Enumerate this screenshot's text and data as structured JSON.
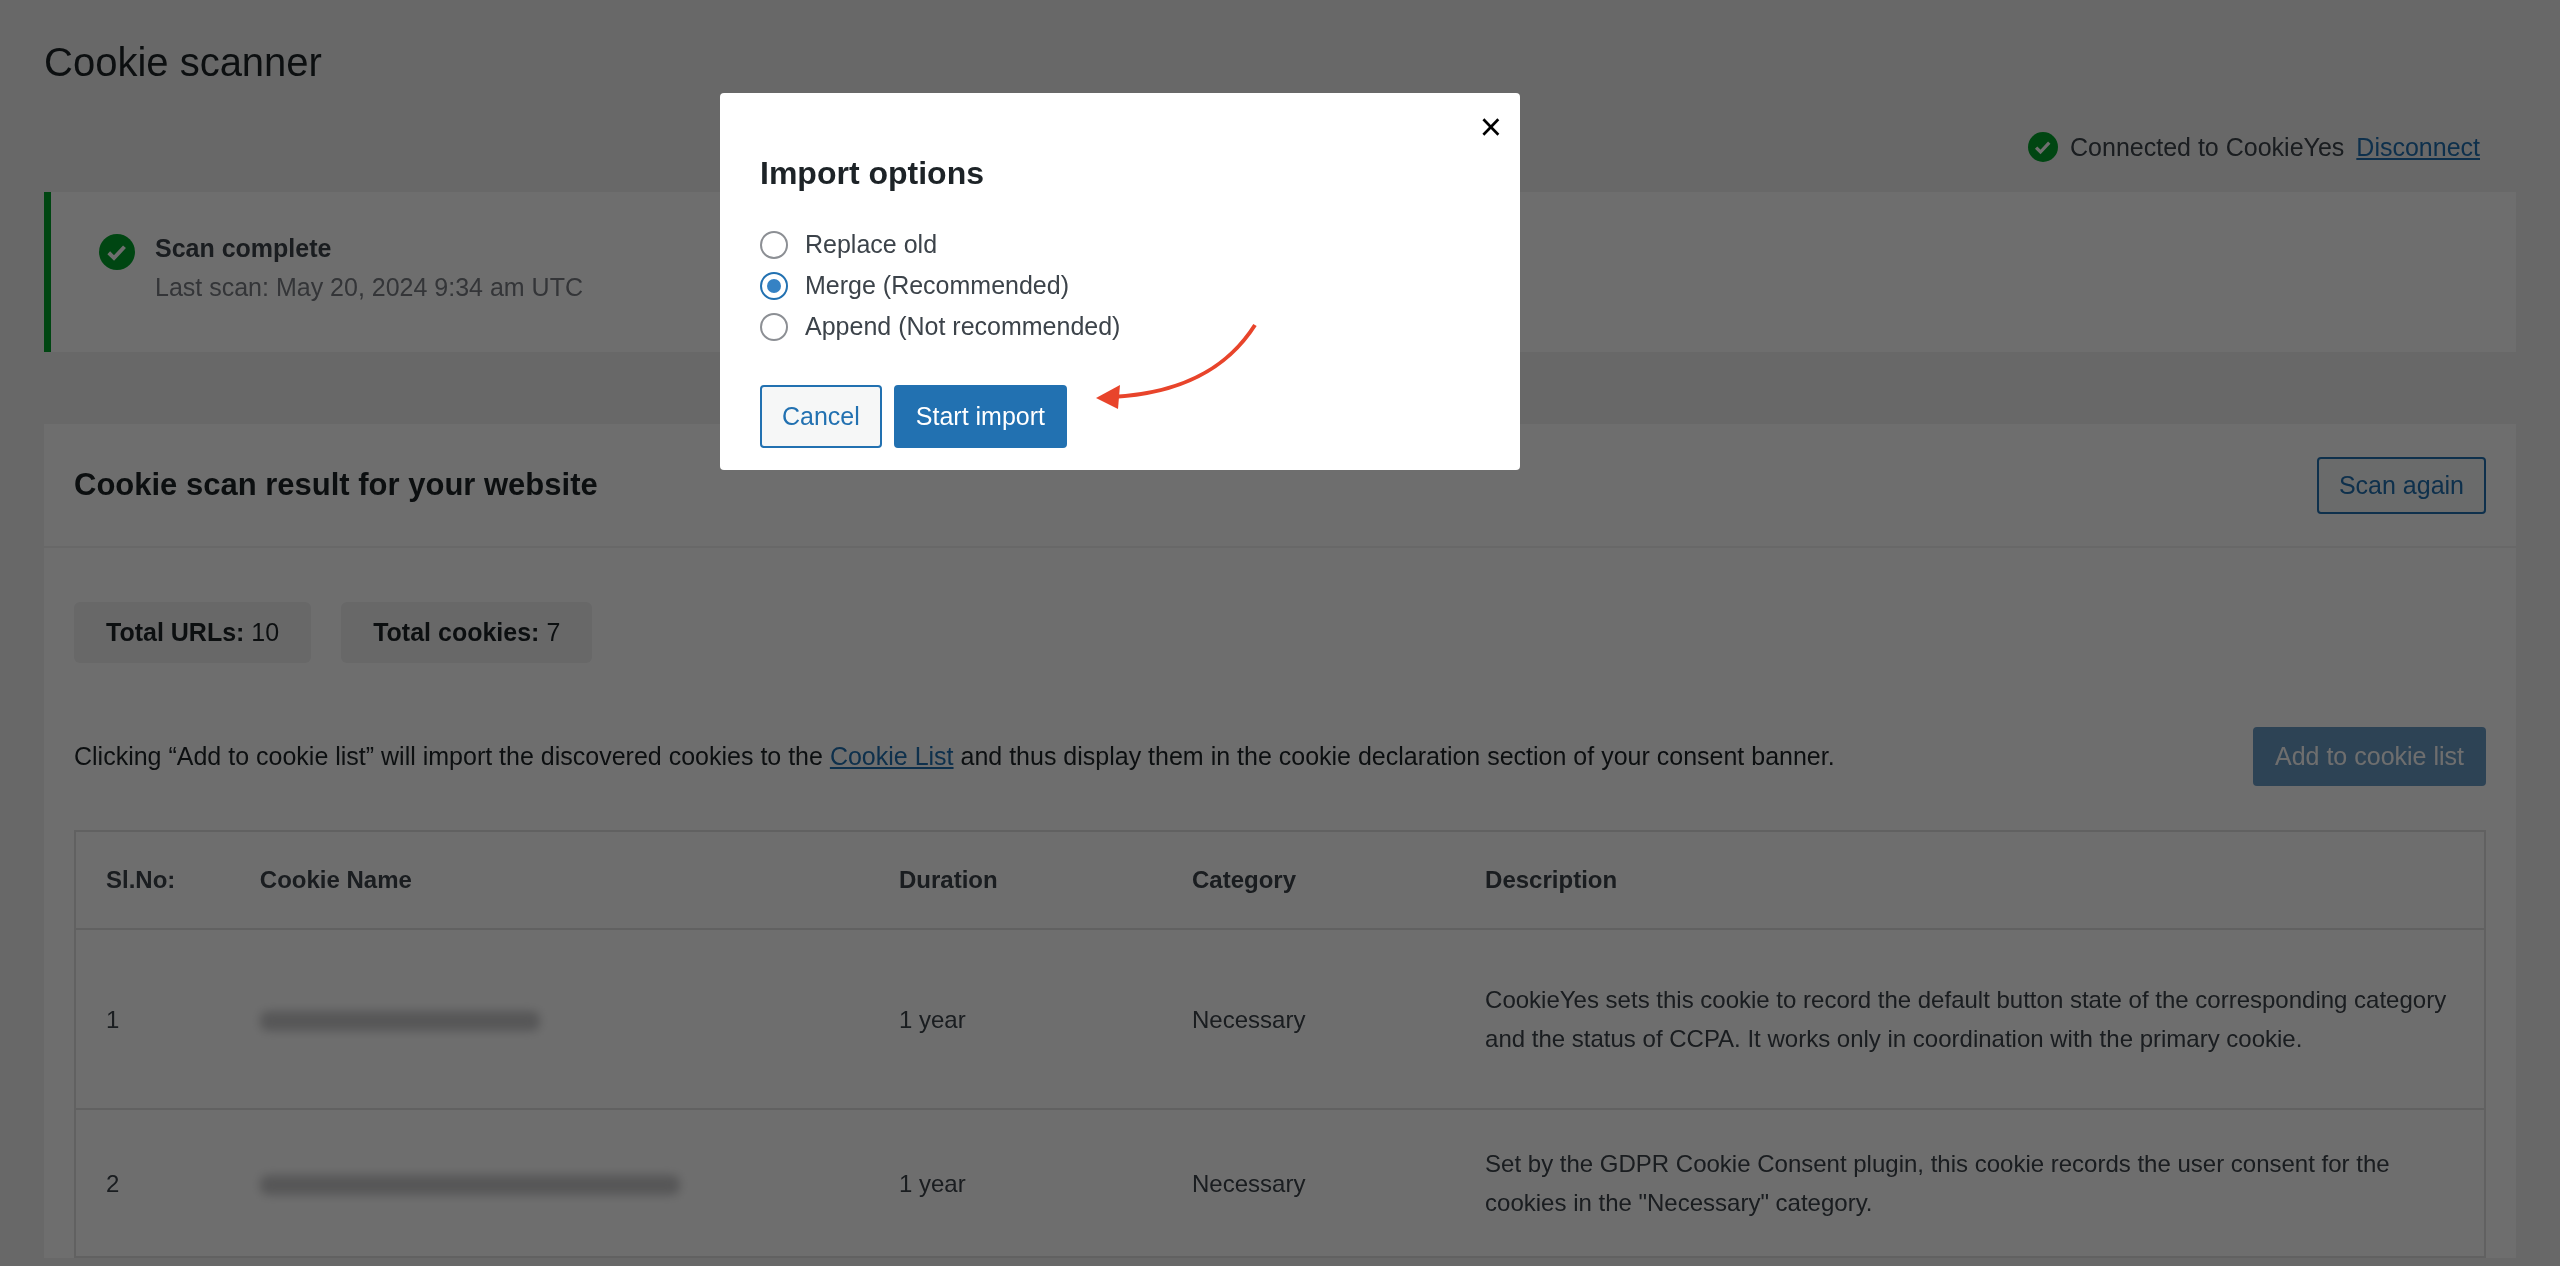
{
  "page_title": "Cookie scanner",
  "connection": {
    "status": "Connected to CookieYes",
    "link": "Disconnect"
  },
  "scan_notice": {
    "title": "Scan complete",
    "last_scan": "Last scan: May 20, 2024 9:34 am UTC"
  },
  "results": {
    "title": "Cookie scan result for your website",
    "scan_again": "Scan again",
    "stats": [
      "**Total URLs:** 10",
      "**Total cookies:** 7"
    ],
    "note_before": "Clicking “Add to cookie list” will import the discovered cookies to the ",
    "note_link": "Cookie List",
    "note_after": " and thus display them in the cookie declaration section of your consent banner.",
    "add_button": "Add to cookie list",
    "table": {
      "columns": [
        "Sl.No:",
        "Cookie Name",
        "Duration",
        "Category",
        "Description"
      ],
      "rows": [
        {
          "sl": "1",
          "name_blurred": true,
          "duration": "1 year",
          "category": "Necessary",
          "description": "CookieYes sets this cookie to record the default button state of the corresponding category and the status of CCPA. It works only in coordination with the primary cookie."
        },
        {
          "sl": "2",
          "name_blurred": true,
          "duration": "1 year",
          "category": "Necessary",
          "description": "Set by the GDPR Cookie Consent plugin, this cookie records the user consent for the cookies in the \"Necessary\" category."
        }
      ]
    }
  },
  "modal": {
    "close": "×",
    "title": "Import options",
    "options": [
      {
        "label": "Replace old",
        "selected": false
      },
      {
        "label": "Merge (Recommended)",
        "selected": true
      },
      {
        "label": "Append (Not recommended)",
        "selected": false
      }
    ],
    "buttons": [
      {
        "label": "Cancel",
        "kind": "secondary"
      },
      {
        "label": "Start import",
        "kind": "primary"
      }
    ],
    "annotation_arrow": true
  }
}
